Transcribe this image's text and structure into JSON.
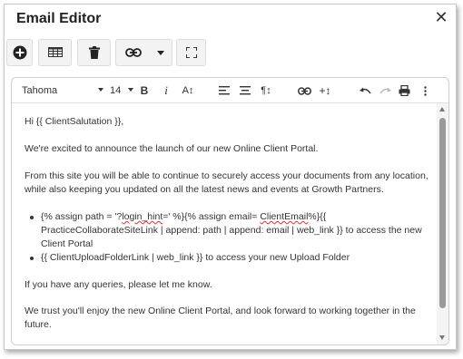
{
  "window": {
    "title": "Email Editor"
  },
  "toolbar": {
    "buttons": [
      {
        "icon": "plus-circle-icon"
      },
      {
        "icon": "table-icon"
      },
      {
        "icon": "trash-icon"
      },
      {
        "icon": "link-icon"
      },
      {
        "icon": "chevron-down-icon"
      },
      {
        "icon": "fullscreen-icon"
      }
    ]
  },
  "format_bar": {
    "font_family": "Tahoma",
    "font_size": "14",
    "bold_label": "B",
    "italic_label": "i",
    "font_size_tool_label": "A↕",
    "paragraph_label": "¶↕",
    "insert_label": "+↕"
  },
  "content": {
    "greeting": "Hi {{ ClientSalutation }},",
    "para1": "We're excited to announce the launch of our new Online Client Portal.",
    "para2": "From this site you will be able to continue to securely access your documents from any location, while also keeping you updated on all the latest news and events at Growth Partners.",
    "bullet1_a": "{% assign path = '?",
    "bullet1_b": "login_hint",
    "bullet1_c": "=' %}{% assign email= ",
    "bullet1_d": "ClientEmail",
    "bullet1_e": "%}{{ PracticeCollaborateSiteLink | append: path | append: email | web_link }} to access the new Client Portal",
    "bullet2": "{{ ClientUploadFolderLink | web_link }} to access your new Upload Folder",
    "para3": "If you have any queries, please let me know.",
    "para4": "We trust you'll enjoy the new Online Client Portal, and look forward to working together in the future."
  }
}
